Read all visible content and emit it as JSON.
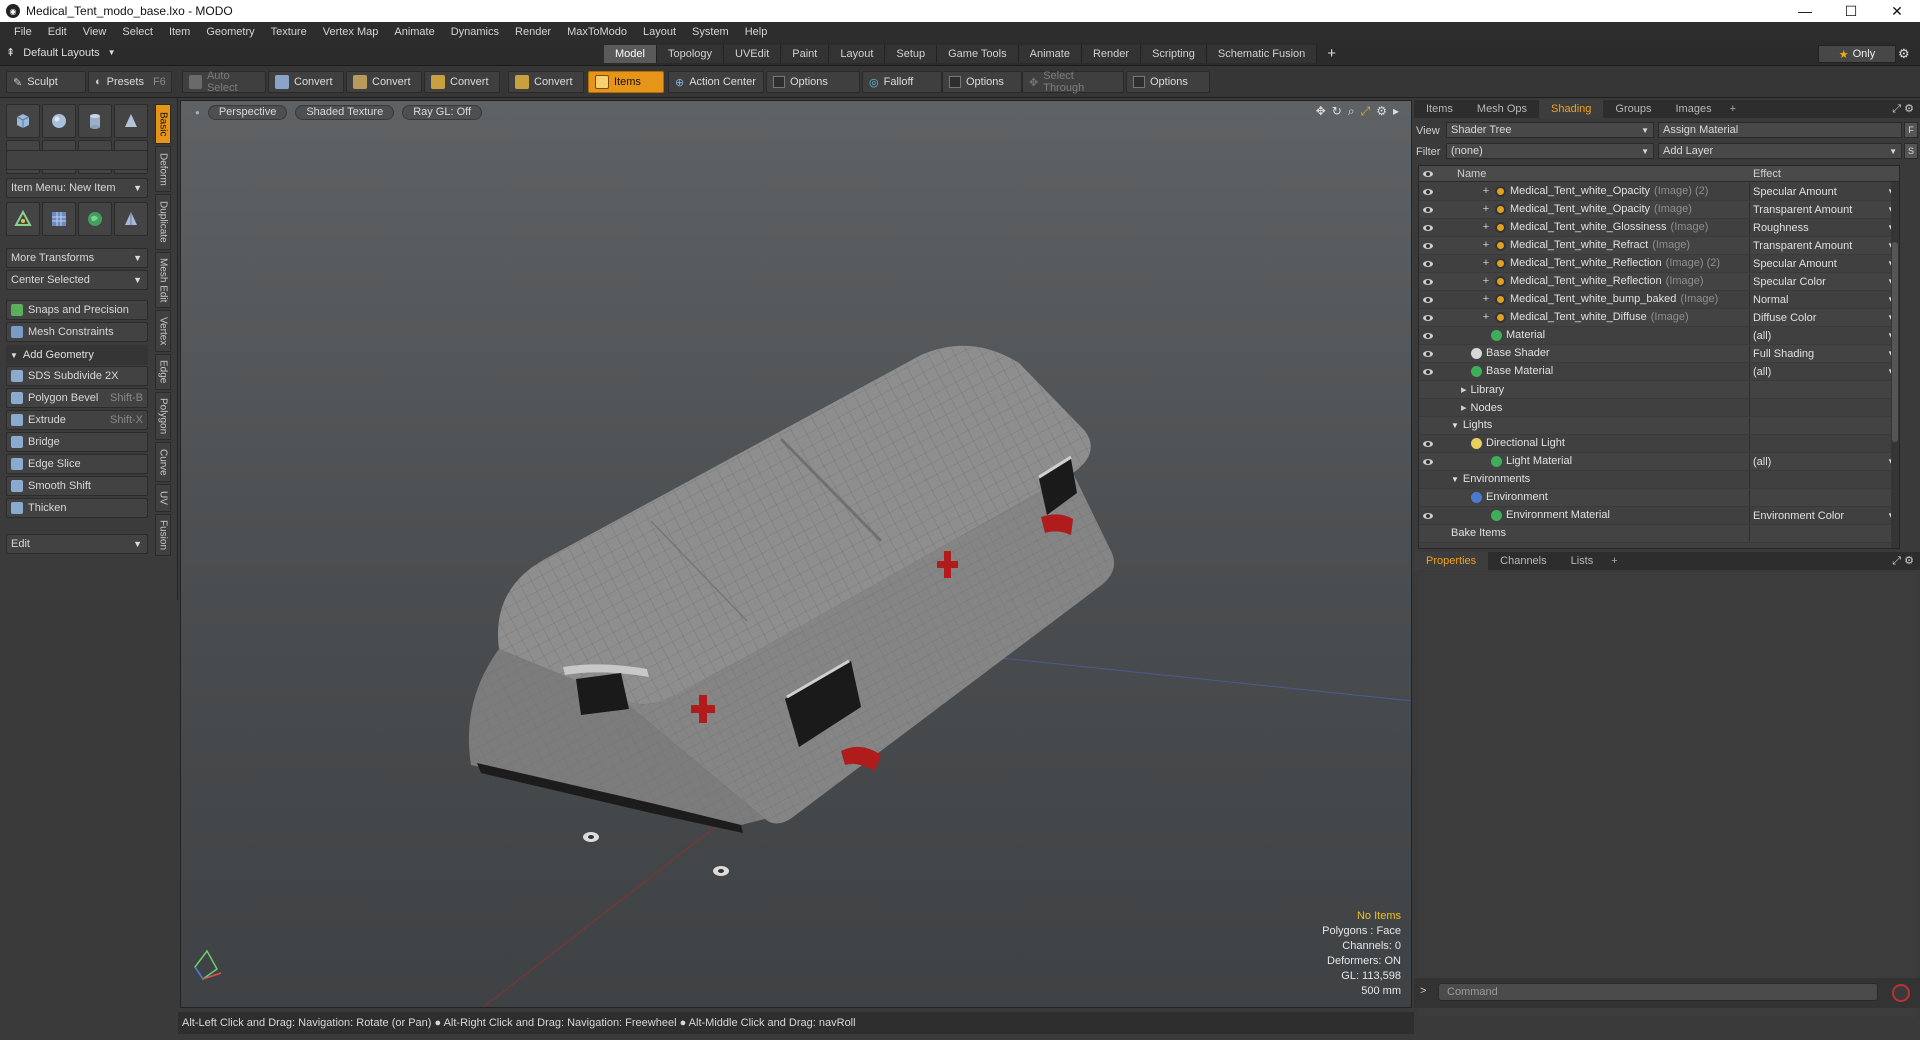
{
  "window": {
    "title": "Medical_Tent_modo_base.lxo - MODO",
    "app_icon": "modo-logo-icon",
    "controls": {
      "minimize": "—",
      "maximize": "☐",
      "close": "✕"
    }
  },
  "menubar": [
    "File",
    "Edit",
    "View",
    "Select",
    "Item",
    "Geometry",
    "Texture",
    "Vertex Map",
    "Animate",
    "Dynamics",
    "Render",
    "MaxToModo",
    "Layout",
    "System",
    "Help"
  ],
  "layoutbar": {
    "layouts_label": "Default Layouts",
    "tabs": [
      "Model",
      "Topology",
      "UVEdit",
      "Paint",
      "Layout",
      "Setup",
      "Game Tools",
      "Animate",
      "Render",
      "Scripting",
      "Schematic Fusion"
    ],
    "active_tab": "Model",
    "plus": "+",
    "only_label": "Only"
  },
  "toolbar": {
    "sculpt": "Sculpt",
    "presets": "Presets",
    "presets_key": "F6",
    "auto_select": "Auto Select",
    "convert1": "Convert",
    "convert2": "Convert",
    "convert3": "Convert",
    "convert4": "Convert",
    "items": "Items",
    "action_center": "Action Center",
    "options1": "Options",
    "falloff": "Falloff",
    "options2": "Options",
    "select_through": "Select Through",
    "options3": "Options"
  },
  "leftpanel": {
    "item_menu": "Item Menu: New Item",
    "more_transforms": "More Transforms",
    "center_selected": "Center Selected",
    "snaps": "Snaps and Precision",
    "mesh_constraints": "Mesh Constraints",
    "add_geometry": "Add Geometry",
    "tools": [
      {
        "label": "SDS Subdivide 2X",
        "shortcut": ""
      },
      {
        "label": "Polygon Bevel",
        "shortcut": "Shift-B"
      },
      {
        "label": "Extrude",
        "shortcut": "Shift-X"
      },
      {
        "label": "Bridge",
        "shortcut": ""
      },
      {
        "label": "Edge Slice",
        "shortcut": ""
      },
      {
        "label": "Smooth Shift",
        "shortcut": ""
      },
      {
        "label": "Thicken",
        "shortcut": ""
      }
    ],
    "edit": "Edit",
    "vtabs": [
      "Basic",
      "Deform",
      "Duplicate",
      "Mesh Edit",
      "Vertex",
      "Edge",
      "Polygon",
      "Curve",
      "UV",
      "Fusion"
    ]
  },
  "viewport": {
    "perspective": "Perspective",
    "shaded_texture": "Shaded Texture",
    "raygl": "Ray GL: Off",
    "info": {
      "no_items": "No Items",
      "polygons": "Polygons : Face",
      "channels": "Channels: 0",
      "deformers": "Deformers: ON",
      "gl": "GL: 113,598",
      "scale": "500 mm"
    }
  },
  "statusbar": "Alt-Left Click and Drag: Navigation: Rotate (or Pan) ● Alt-Right Click and Drag: Navigation: Freewheel ● Alt-Middle Click and Drag: navRoll",
  "rightpanel": {
    "tabs": [
      "Items",
      "Mesh Ops",
      "Shading",
      "Groups",
      "Images"
    ],
    "active_tab": "Shading",
    "view_label": "View",
    "view_value": "Shader Tree",
    "assign_material": "Assign Material",
    "assign_btn": "F",
    "filter_label": "Filter",
    "filter_value": "(none)",
    "add_layer": "Add Layer",
    "add_layer_btn": "S",
    "col_name": "Name",
    "col_effect": "Effect",
    "rows": [
      {
        "name": "Medical_Tent_white_Opacity",
        "tag": "(Image) (2)",
        "effect": "Specular Amount",
        "eye": true,
        "indent": 62,
        "kind": "image",
        "plus": true
      },
      {
        "name": "Medical_Tent_white_Opacity",
        "tag": "(Image)",
        "effect": "Transparent Amount",
        "eye": true,
        "indent": 62,
        "kind": "image",
        "plus": true
      },
      {
        "name": "Medical_Tent_white_Glossiness",
        "tag": "(Image)",
        "effect": "Roughness",
        "eye": true,
        "indent": 62,
        "kind": "image",
        "plus": true
      },
      {
        "name": "Medical_Tent_white_Refract",
        "tag": "(Image)",
        "effect": "Transparent Amount",
        "eye": true,
        "indent": 62,
        "kind": "image",
        "plus": true
      },
      {
        "name": "Medical_Tent_white_Reflection",
        "tag": "(Image) (2)",
        "effect": "Specular Amount",
        "eye": true,
        "indent": 62,
        "kind": "image",
        "plus": true
      },
      {
        "name": "Medical_Tent_white_Reflection",
        "tag": "(Image)",
        "effect": "Specular Color",
        "eye": true,
        "indent": 62,
        "kind": "image",
        "plus": true
      },
      {
        "name": "Medical_Tent_white_bump_baked",
        "tag": "(Image)",
        "effect": "Normal",
        "eye": true,
        "indent": 62,
        "kind": "image",
        "plus": true
      },
      {
        "name": "Medical_Tent_white_Diffuse",
        "tag": "(Image)",
        "effect": "Diffuse Color",
        "eye": true,
        "indent": 62,
        "kind": "image",
        "plus": true
      },
      {
        "name": "Material",
        "tag": "",
        "effect": "(all)",
        "eye": true,
        "indent": 72,
        "kind": "material",
        "plus": false
      },
      {
        "name": "Base Shader",
        "tag": "",
        "effect": "Full Shading",
        "eye": true,
        "indent": 52,
        "kind": "shader",
        "plus": false
      },
      {
        "name": "Base Material",
        "tag": "",
        "effect": "(all)",
        "eye": true,
        "indent": 52,
        "kind": "material",
        "plus": false
      },
      {
        "name": "Library",
        "tag": "",
        "effect": "",
        "eye": false,
        "indent": 42,
        "kind": "folder",
        "plus": false
      },
      {
        "name": "Nodes",
        "tag": "",
        "effect": "",
        "eye": false,
        "indent": 42,
        "kind": "folder",
        "plus": false
      },
      {
        "name": "Lights",
        "tag": "",
        "effect": "",
        "eye": false,
        "indent": 32,
        "kind": "group",
        "plus": false
      },
      {
        "name": "Directional Light",
        "tag": "",
        "effect": "",
        "eye": true,
        "indent": 52,
        "kind": "light",
        "plus": false
      },
      {
        "name": "Light Material",
        "tag": "",
        "effect": "(all)",
        "eye": true,
        "indent": 72,
        "kind": "material",
        "plus": false
      },
      {
        "name": "Environments",
        "tag": "",
        "effect": "",
        "eye": false,
        "indent": 32,
        "kind": "group",
        "plus": false
      },
      {
        "name": "Environment",
        "tag": "",
        "effect": "",
        "eye": false,
        "indent": 52,
        "kind": "env",
        "plus": false
      },
      {
        "name": "Environment Material",
        "tag": "",
        "effect": "Environment Color",
        "eye": true,
        "indent": 72,
        "kind": "material",
        "plus": false
      },
      {
        "name": "Bake Items",
        "tag": "",
        "effect": "",
        "eye": false,
        "indent": 32,
        "kind": "none",
        "plus": false
      }
    ],
    "bottom_tabs": [
      "Properties",
      "Channels",
      "Lists"
    ],
    "bottom_active": "Properties",
    "command_placeholder": "Command"
  },
  "colors": {
    "accent": "#e79519",
    "active_tab_text": "#f0a020",
    "cross": "#b01c1c"
  }
}
